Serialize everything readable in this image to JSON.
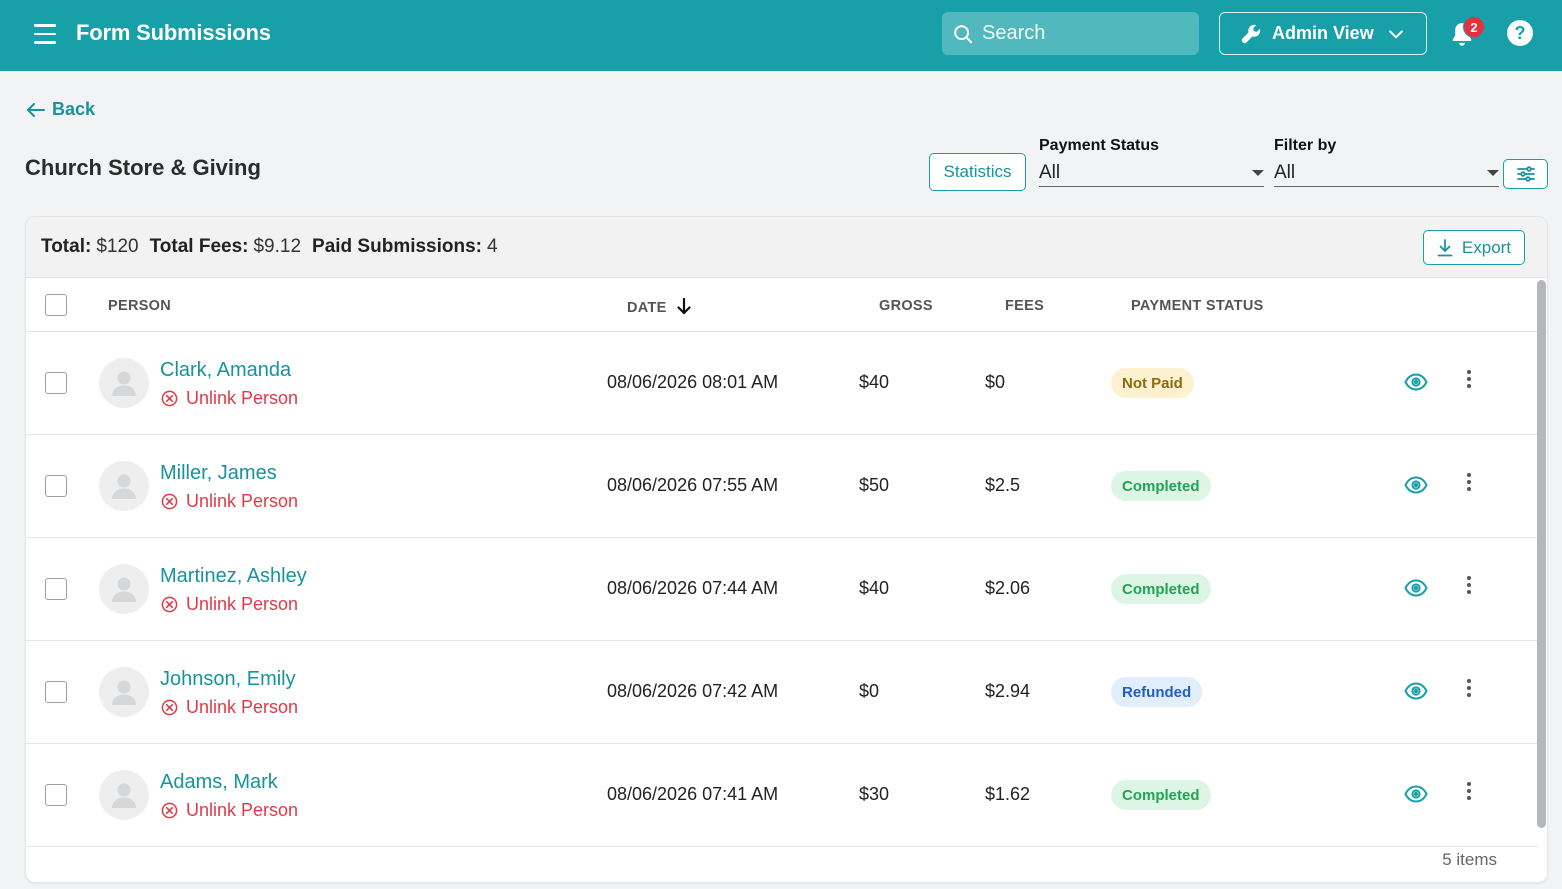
{
  "app": {
    "title": "Form Submissions"
  },
  "search": {
    "placeholder": "Search"
  },
  "admin": {
    "label": "Admin View"
  },
  "notifications": {
    "count": "2"
  },
  "help": {
    "label": "?"
  },
  "nav": {
    "back_label": "Back"
  },
  "page": {
    "title": "Church Store & Giving"
  },
  "toolbar": {
    "statistics_label": "Statistics",
    "payment_status": {
      "label": "Payment Status",
      "value": "All"
    },
    "filter_by": {
      "label": "Filter by",
      "value": "All"
    }
  },
  "summary": {
    "total_label": "Total:",
    "total_value": "$120",
    "fees_label": "Total Fees:",
    "fees_value": "$9.12",
    "paid_label": "Paid Submissions:",
    "paid_value": "4",
    "export_label": "Export"
  },
  "columns": {
    "person": "PERSON",
    "date": "DATE",
    "gross": "GROSS",
    "fees": "FEES",
    "status": "PAYMENT STATUS"
  },
  "rows": [
    {
      "name": "Clark, Amanda",
      "unlink": "Unlink Person",
      "date": "08/06/2026 08:01 AM",
      "gross": "$40",
      "fees": "$0",
      "status": "Not Paid"
    },
    {
      "name": "Miller, James",
      "unlink": "Unlink Person",
      "date": "08/06/2026 07:55 AM",
      "gross": "$50",
      "fees": "$2.5",
      "status": "Completed"
    },
    {
      "name": "Martinez, Ashley",
      "unlink": "Unlink Person",
      "date": "08/06/2026 07:44 AM",
      "gross": "$40",
      "fees": "$2.06",
      "status": "Completed"
    },
    {
      "name": "Johnson, Emily",
      "unlink": "Unlink Person",
      "date": "08/06/2026 07:42 AM",
      "gross": "$0",
      "fees": "$2.94",
      "status": "Refunded"
    },
    {
      "name": "Adams, Mark",
      "unlink": "Unlink Person",
      "date": "08/06/2026 07:41 AM",
      "gross": "$30",
      "fees": "$1.62",
      "status": "Completed"
    }
  ],
  "footer": {
    "count": "5 items"
  },
  "status_colors": {
    "Not Paid": {
      "bg": "#fdf1cf",
      "fg": "#8a6a12"
    },
    "Completed": {
      "bg": "#dcf5e4",
      "fg": "#22a355"
    },
    "Refunded": {
      "bg": "#e3eefc",
      "fg": "#1f5fc4"
    }
  },
  "colors": {
    "brand": "#17a0a8",
    "danger": "#e03a48"
  },
  "icons": [
    "menu-icon",
    "search-icon",
    "wrench-icon",
    "chevron-down-icon",
    "bell-icon",
    "help-icon",
    "arrow-left-icon",
    "sliders-icon",
    "download-icon",
    "arrow-down-icon",
    "user-icon",
    "close-circle-icon",
    "eye-icon",
    "kebab-icon"
  ]
}
